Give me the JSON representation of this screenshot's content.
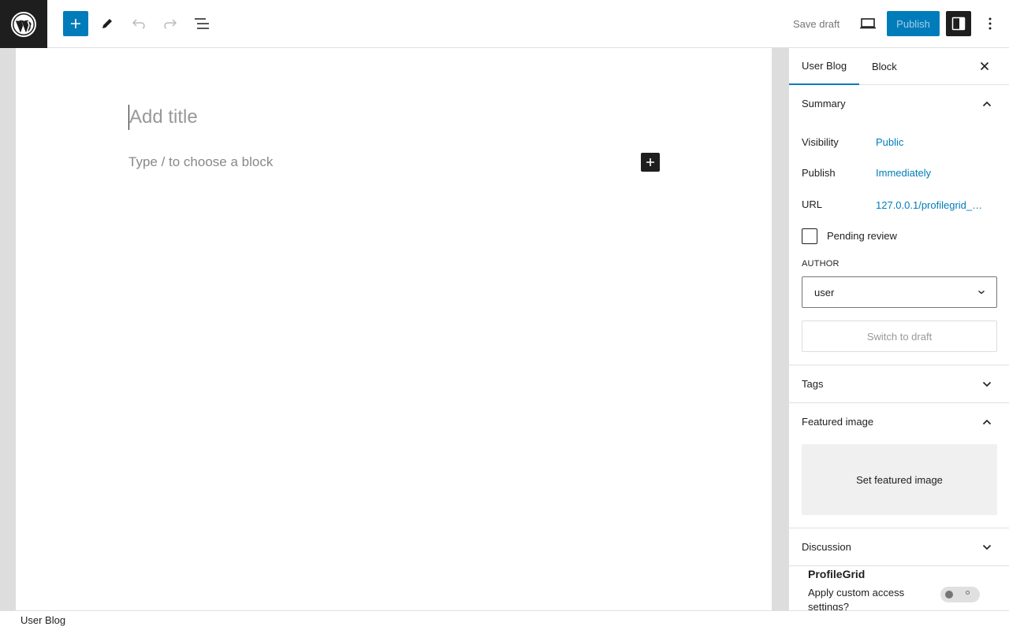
{
  "toolbar": {
    "save_draft_label": "Save draft",
    "publish_label": "Publish"
  },
  "editor": {
    "title_placeholder": "Add title",
    "block_placeholder": "Type / to choose a block"
  },
  "sidebar": {
    "tabs": [
      {
        "label": "User Blog",
        "active": true
      },
      {
        "label": "Block",
        "active": false
      }
    ],
    "summary": {
      "title": "Summary",
      "visibility_label": "Visibility",
      "visibility_value": "Public",
      "publish_label": "Publish",
      "publish_value": "Immediately",
      "url_label": "URL",
      "url_value": "127.0.0.1/profilegrid_…",
      "pending_review_label": "Pending review",
      "pending_review_checked": false,
      "author_label": "AUTHOR",
      "author_value": "user",
      "switch_to_draft_label": "Switch to draft"
    },
    "tags": {
      "title": "Tags"
    },
    "featured_image": {
      "title": "Featured image",
      "set_label": "Set featured image"
    },
    "discussion": {
      "title": "Discussion"
    },
    "profilegrid": {
      "title": "ProfileGrid",
      "access_label": "Apply custom access settings?",
      "access_enabled": false
    }
  },
  "footer": {
    "breadcrumb": "User Blog"
  },
  "colors": {
    "accent": "#007cba",
    "dark": "#1e1e1e"
  }
}
